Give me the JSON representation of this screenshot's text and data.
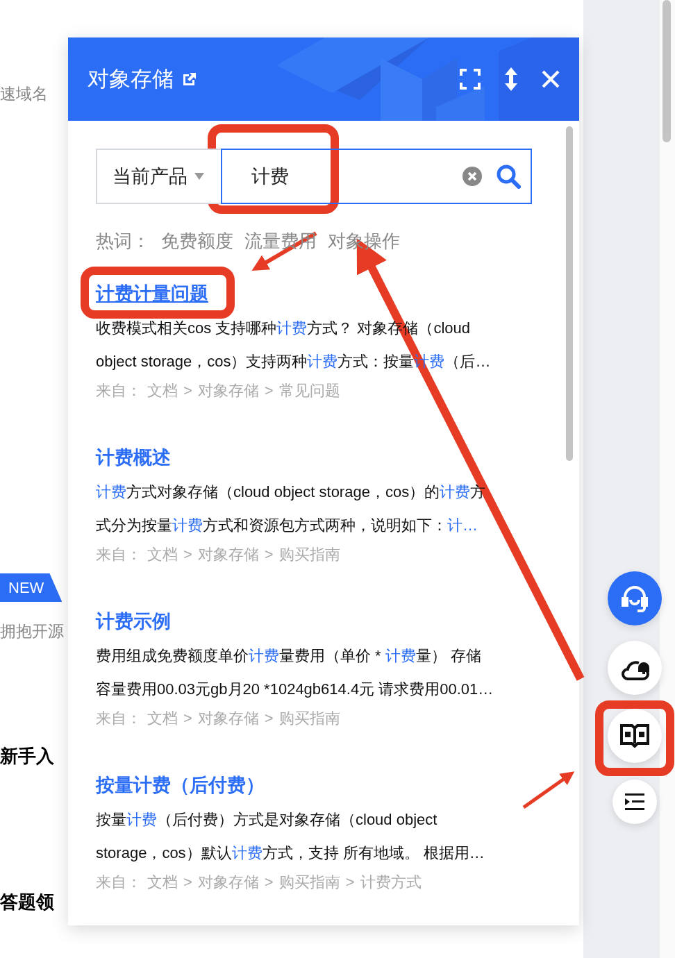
{
  "background_page": {
    "items": [
      {
        "kind": "muted",
        "text": "速域名"
      },
      {
        "kind": "badge",
        "text": "NEW"
      },
      {
        "kind": "muted",
        "text": "拥抱开源"
      },
      {
        "kind": "heading",
        "text": "新手入"
      },
      {
        "kind": "heading",
        "text": "答题领"
      }
    ]
  },
  "panel": {
    "title": "对象存储",
    "search": {
      "scope": "当前产品",
      "value": "计费"
    },
    "hot_words": {
      "label": "热词：",
      "words": [
        "免费额度",
        "流量费用",
        "对象操作"
      ]
    },
    "results": [
      {
        "title": "计费计量问题",
        "selected": true,
        "lines": [
          [
            {
              "text": "收费模式相关cos 支持哪种",
              "hl": false
            },
            {
              "text": "计费",
              "hl": true
            },
            {
              "text": "方式？ 对象存储（cloud",
              "hl": false
            }
          ],
          [
            {
              "text": "object storage，cos）支持两种",
              "hl": false
            },
            {
              "text": "计费",
              "hl": true
            },
            {
              "text": "方式：按量",
              "hl": false
            },
            {
              "text": "计费",
              "hl": true
            },
            {
              "text": "（后…",
              "hl": false
            }
          ]
        ],
        "source": [
          "来自：",
          "文档",
          ">",
          "对象存储",
          ">",
          "常见问题"
        ]
      },
      {
        "title": "计费概述",
        "selected": false,
        "lines": [
          [
            {
              "text": "计费",
              "hl": true
            },
            {
              "text": "方式对象存储（cloud object storage，cos）的",
              "hl": false
            },
            {
              "text": "计费",
              "hl": true
            },
            {
              "text": "方",
              "hl": false
            }
          ],
          [
            {
              "text": "式分为按量",
              "hl": false
            },
            {
              "text": "计费",
              "hl": true
            },
            {
              "text": "方式和资源包方式两种，说明如下：",
              "hl": false
            },
            {
              "text": "计…",
              "hl": true
            }
          ]
        ],
        "source": [
          "来自：",
          "文档",
          ">",
          "对象存储",
          ">",
          "购买指南"
        ]
      },
      {
        "title": "计费示例",
        "selected": false,
        "lines": [
          [
            {
              "text": "费用组成免费额度单价",
              "hl": false
            },
            {
              "text": "计费",
              "hl": true
            },
            {
              "text": "量费用（单价 * ",
              "hl": false
            },
            {
              "text": "计费",
              "hl": true
            },
            {
              "text": "量） 存储",
              "hl": false
            }
          ],
          [
            {
              "text": "容量费用00.03元gb月20 *1024gb614.4元 请求费用00.01…",
              "hl": false
            }
          ]
        ],
        "source": [
          "来自：",
          "文档",
          ">",
          "对象存储",
          ">",
          "购买指南"
        ]
      },
      {
        "title": "按量计费（后付费）",
        "selected": false,
        "lines": [
          [
            {
              "text": "按量",
              "hl": false
            },
            {
              "text": "计费",
              "hl": true
            },
            {
              "text": "（后付费）方式是对象存储（cloud object",
              "hl": false
            }
          ],
          [
            {
              "text": "storage，cos）默认",
              "hl": false
            },
            {
              "text": "计费",
              "hl": true
            },
            {
              "text": "方式，支持 所有地域。 根据用…",
              "hl": false
            }
          ]
        ],
        "source": [
          "来自：",
          "文档",
          ">",
          "对象存储",
          ">",
          "购买指南",
          ">",
          "计费方式"
        ]
      }
    ]
  },
  "float_buttons": [
    {
      "kind": "support",
      "selected": true
    },
    {
      "kind": "cloud",
      "selected": false
    },
    {
      "kind": "docs",
      "selected": false
    },
    {
      "kind": "outline",
      "selected": false
    }
  ]
}
